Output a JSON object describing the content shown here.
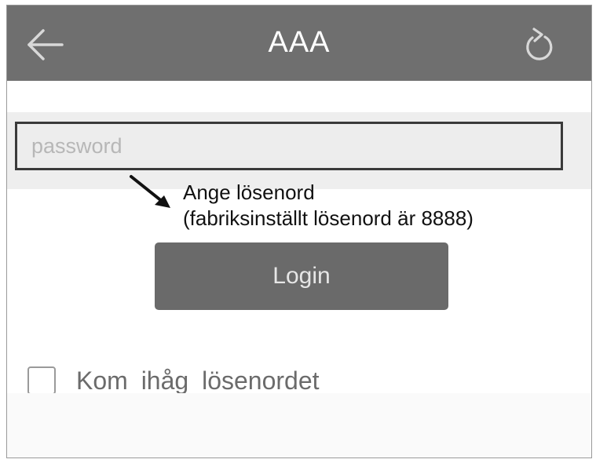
{
  "appbar": {
    "title": "AAA",
    "back_icon": "arrow-left-icon",
    "refresh_icon": "refresh-icon"
  },
  "password": {
    "placeholder": "password",
    "value": ""
  },
  "annotation": {
    "line1": "Ange lösenord",
    "line2": "(fabriksinställt lösenord är 8888)",
    "arrow_icon": "arrow-down-right-icon"
  },
  "login": {
    "label": "Login"
  },
  "remember": {
    "label": "Kom ihåg lösenordet",
    "checked": false
  },
  "colors": {
    "appbar": "#6f6f6f",
    "button": "#6a6a6a",
    "input_bg": "#ededed"
  }
}
